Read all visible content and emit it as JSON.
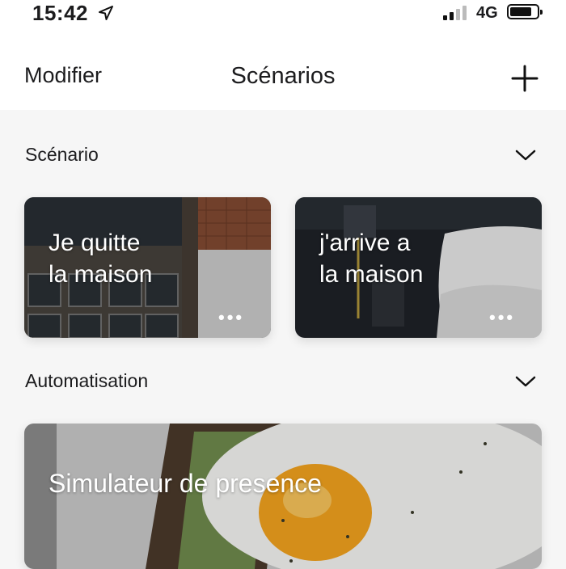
{
  "status": {
    "time": "15:42",
    "network": "4G"
  },
  "nav": {
    "left_label": "Modifier",
    "title": "Scénarios"
  },
  "sections": {
    "scenario": {
      "title": "Scénario",
      "cards": [
        {
          "line1": "Je quitte",
          "line2": "la maison",
          "more": "•••"
        },
        {
          "line1": "j'arrive a",
          "line2": "la maison",
          "more": "•••"
        }
      ]
    },
    "automation": {
      "title": "Automatisation",
      "cards": [
        {
          "label": "Simulateur de presence"
        }
      ]
    }
  },
  "icons": {
    "location": "location-arrow-icon",
    "signal": "cellular-signal-icon",
    "battery": "battery-icon",
    "add": "plus-icon",
    "chevron": "chevron-down-icon"
  }
}
